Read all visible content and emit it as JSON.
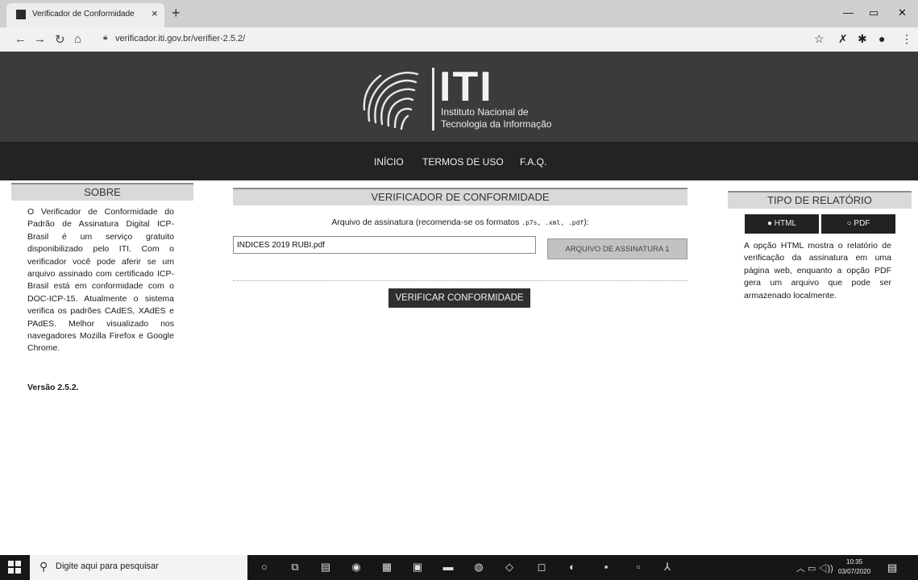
{
  "browser": {
    "tab_title": "Verificador de Conformidade",
    "tab_close": "×",
    "new_tab": "+",
    "url": "verificador.iti.gov.br/verifier-2.5.2/",
    "icons": [
      "back-icon",
      "forward-icon",
      "reload-icon",
      "home-icon",
      "lock-icon",
      "star-icon",
      "extension-icon",
      "puzzle-icon",
      "profile-icon",
      "menu-icon"
    ]
  },
  "header": {
    "logo_main": "ITI",
    "logo_sub_line1": "Instituto Nacional de",
    "logo_sub_line2": "Tecnologia da Informação",
    "nav": [
      "INÍCIO",
      "TERMOS DE USO",
      "F.A.Q."
    ]
  },
  "sobre": {
    "heading": "SOBRE",
    "text": "O Verificador de Conformidade do Padrão de Assinatura Digital ICP-Brasil é um serviço gratuito disponibilizado pelo ITI. Com o verificador você pode aferir se um arquivo assinado com certificado ICP-Brasil está em conformidade com o DOC-ICP-15. Atualmente o sistema verifica os padrões CAdES, XAdES e PAdES. Melhor visualizado nos navegadores Mozilla Firefox e Google Chrome.",
    "versao": "Versão 2.5.2."
  },
  "verificador": {
    "heading": "VERIFICADOR DE CONFORMIDADE",
    "label_prefix": "Arquivo de assinatura (recomenda-se os formatos ",
    "label_formats": ".p7s, .xml, .pdf",
    "label_suffix": "):",
    "file_value": "INDICES 2019 RUBI.pdf",
    "file_button": "ARQUIVO DE ASSINATURA 1",
    "verify_button": "VERIFICAR CONFORMIDADE"
  },
  "relatorio": {
    "heading": "TIPO DE RELATÓRIO",
    "option_html": "HTML",
    "option_pdf": "PDF",
    "selected": "HTML",
    "text": "A opção HTML mostra o relatório de verificação da assinatura em uma página web, enquanto a opção PDF gera um arquivo que pode ser armazenado localmente."
  },
  "taskbar": {
    "search_placeholder": "Digite aqui para pesquisar",
    "time": "10:35",
    "date": "03/07/2020"
  }
}
